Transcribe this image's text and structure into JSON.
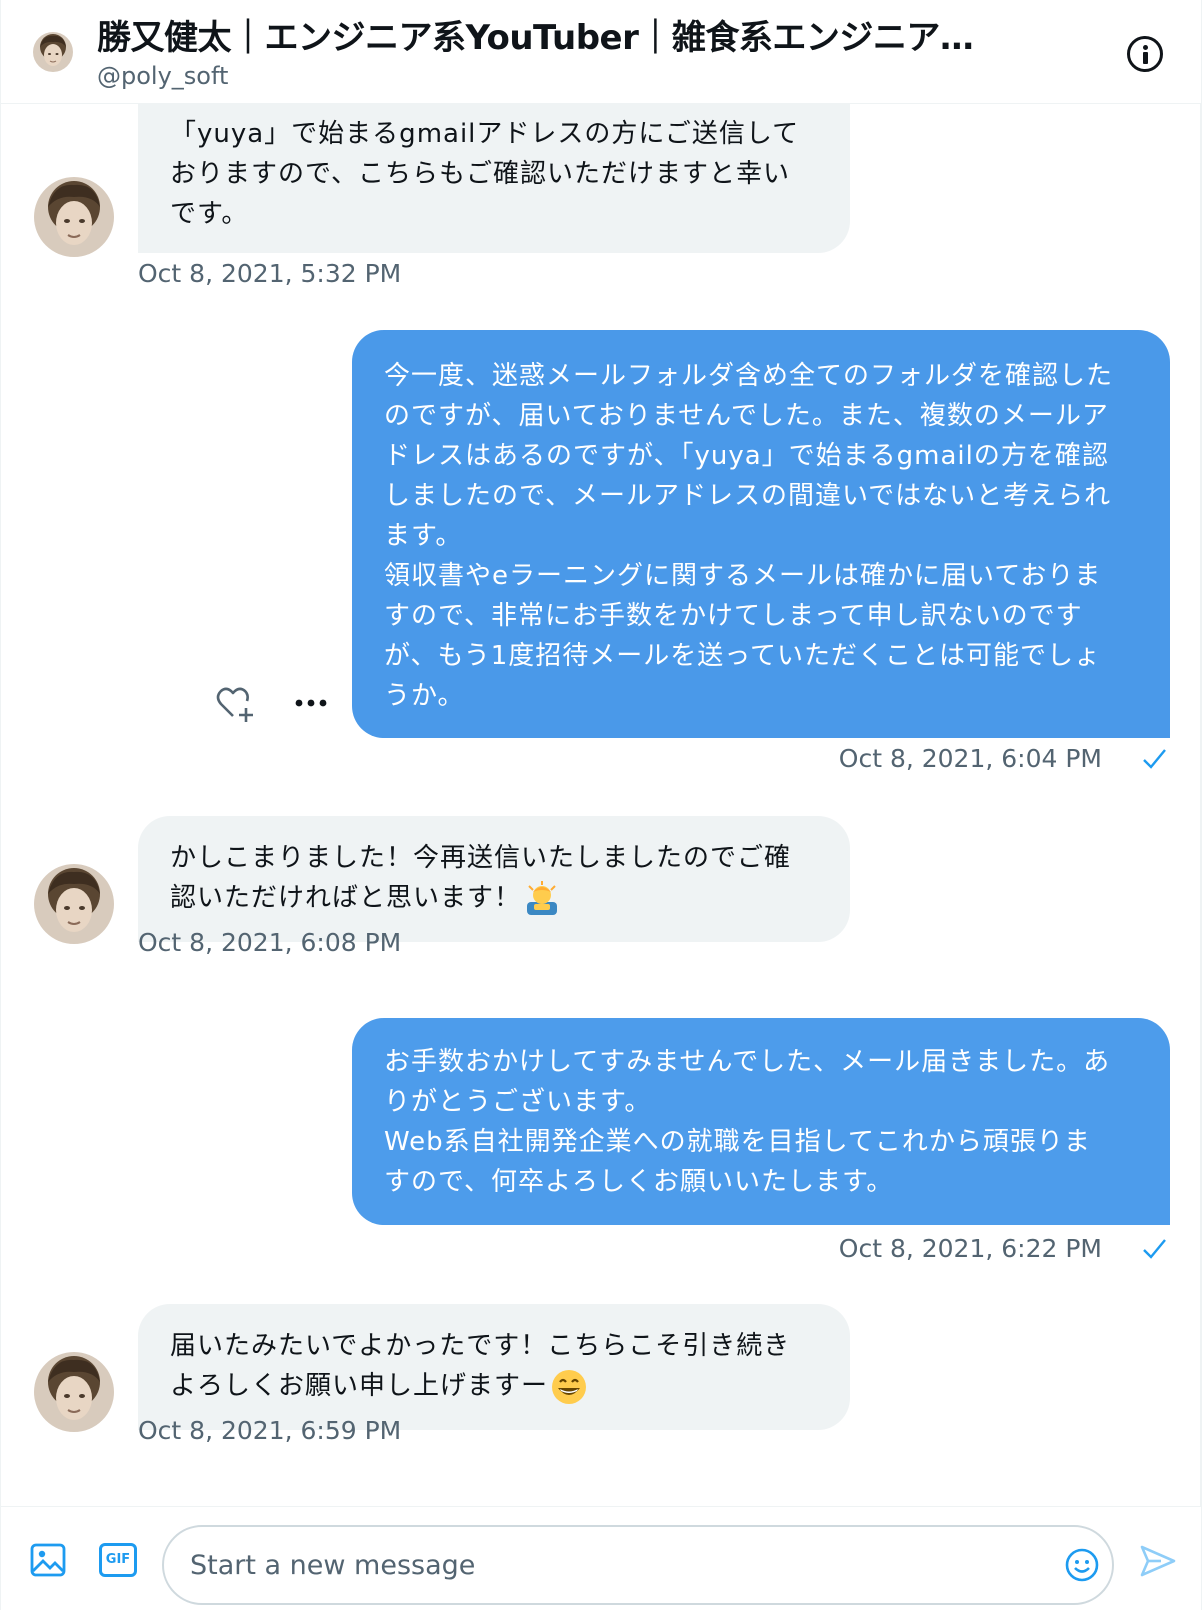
{
  "header": {
    "title": "勝又健太｜エンジニア系YouTuber｜雑食系エンジニア…",
    "handle": "@poly_soft",
    "info_icon": "info-circle-icon"
  },
  "messages": [
    {
      "direction": "in",
      "text": "「yuya」で始まるgmailアドレスの方にご送信して\nおりますので、こちらもご確認いただけますと幸い\nです。",
      "timestamp": "Oct 8, 2021, 5:32 PM"
    },
    {
      "direction": "out",
      "text": "今一度、迷惑メールフォルダ含め全てのフォルダを確認した\nのですが、届いておりませんでした。また、複数のメールア\nドレスはあるのですが、「yuya」で始まるgmailの方を確認\nしましたので、メールアドレスの間違いではないと考えられ\nます。\n領収書やeラーニングに関するメールは確かに届いておりま\nすので、非常にお手数をかけてしまって申し訳ないのです\nが、もう1度招待メールを送っていただくことは可能でしょ\nうか。",
      "timestamp": "Oct 8, 2021, 6:04 PM",
      "status_icon": "check-icon"
    },
    {
      "direction": "in",
      "text": "かしこまりました！今再送信いたしましたのでご確\n認いただければと思います！",
      "emoji": "person-bowing-emoji",
      "timestamp": "Oct 8, 2021, 6:08 PM"
    },
    {
      "direction": "out",
      "text": "お手数おかけしてすみませんでした、メール届きました。あ\nりがとうございます。\nWeb系自社開発企業への就職を目指してこれから頑張りま\nすので、何卒よろしくお願いいたします。",
      "timestamp": "Oct 8, 2021, 6:22 PM",
      "status_icon": "check-icon"
    },
    {
      "direction": "in",
      "text": "届いたみたいでよかったです！こちらこそ引き続き\nよろしくお願い申し上げますー",
      "emoji": "grinning-face-emoji",
      "timestamp": "Oct 8, 2021, 6:59 PM"
    }
  ],
  "message_actions": {
    "react_icon": "heart-plus-icon",
    "more_icon": "more-horizontal-icon"
  },
  "composer": {
    "placeholder": "Start a new message",
    "gif_label": "GIF",
    "media_icon": "image-icon",
    "emoji_icon": "smiley-icon",
    "send_icon": "send-icon"
  },
  "colors": {
    "outgoing_bubble": "#4a99e9",
    "incoming_bubble": "#eff3f4",
    "accent": "#1d9bf0",
    "secondary_text": "#536471"
  }
}
